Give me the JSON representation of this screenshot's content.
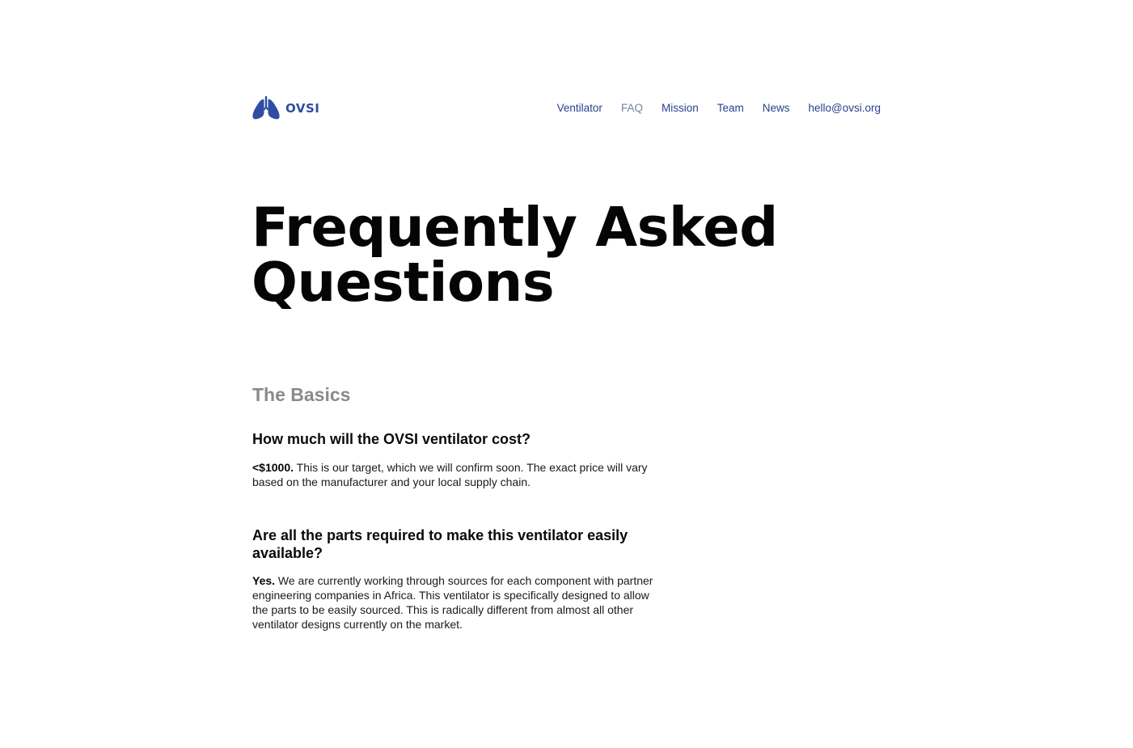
{
  "header": {
    "logo_text": "OVSI",
    "nav": [
      {
        "label": "Ventilator",
        "active": false
      },
      {
        "label": "FAQ",
        "active": true
      },
      {
        "label": "Mission",
        "active": false
      },
      {
        "label": "Team",
        "active": false
      },
      {
        "label": "News",
        "active": false
      },
      {
        "label": "hello@ovsi.org",
        "active": false
      }
    ]
  },
  "hero": {
    "title_line1": "Frequently Asked",
    "title_line2": "Questions"
  },
  "section": {
    "title": "The Basics"
  },
  "faq": [
    {
      "question": "How much will the OVSI ventilator cost?",
      "answer_lead": "<$1000.",
      "answer_body": " This is our target, which we will confirm soon. The exact price will vary based on the manufacturer and your local supply chain."
    },
    {
      "question": "Are all the parts required to make this ventilator easily available?",
      "answer_lead": "Yes.",
      "answer_body": " We are currently working through sources for each component with partner engineering companies in Africa. This ventilator is specifically designed to allow the parts to be easily sourced. This is radically different from almost all other ventilator designs currently on the market."
    }
  ],
  "colors": {
    "brand": "#2f4ea3",
    "nav_link": "#2a3f8f",
    "nav_active": "#7582a6",
    "section_title": "#8a8a8a"
  },
  "icons": {
    "logo": "lungs-icon"
  }
}
